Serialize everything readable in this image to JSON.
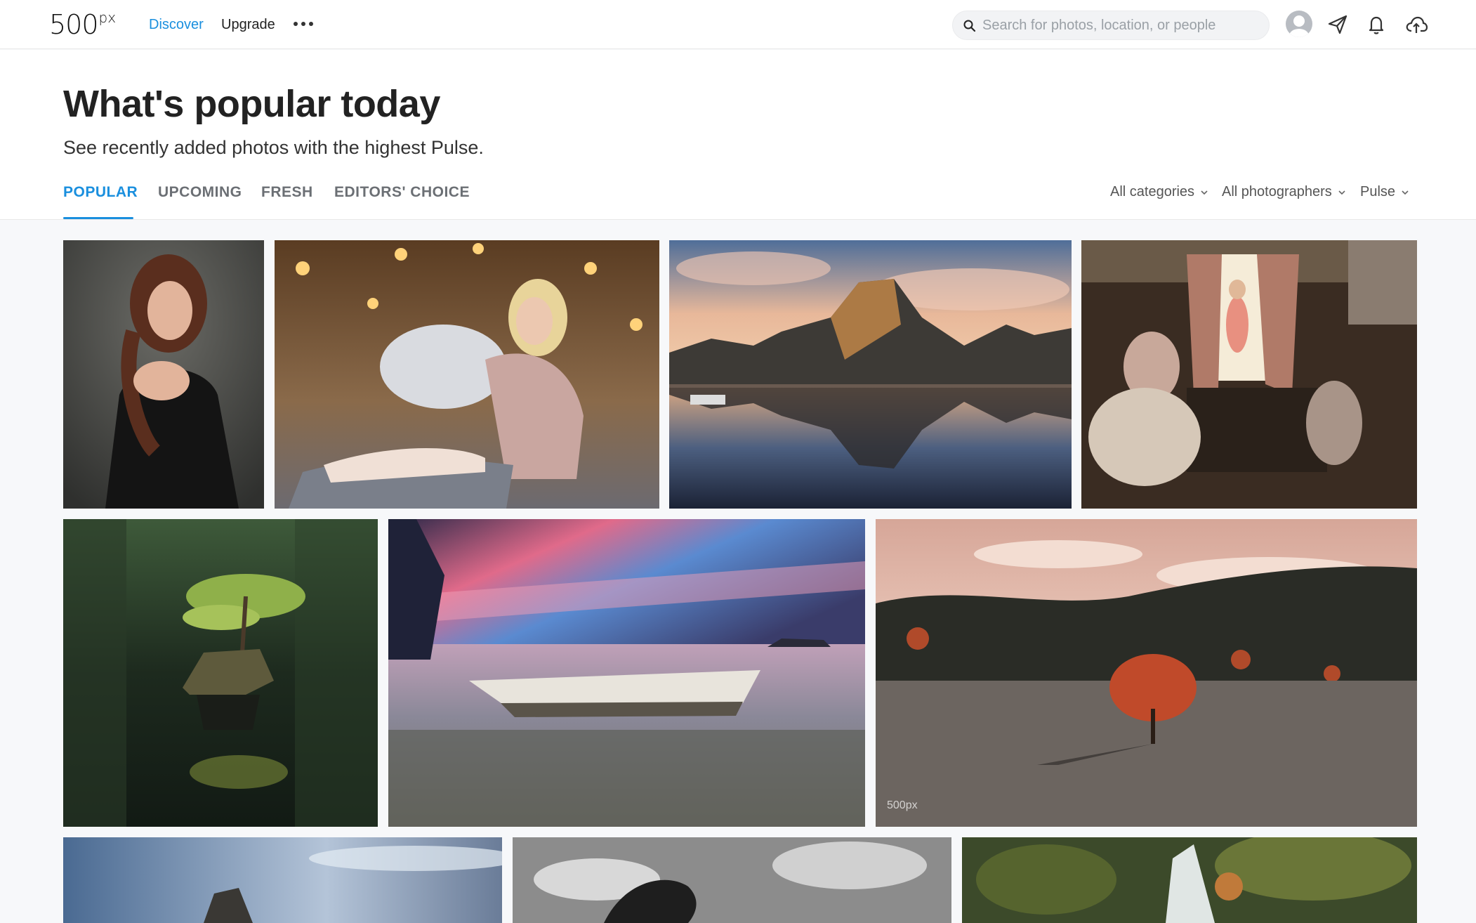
{
  "nav": {
    "logo_main": "500",
    "logo_sup": "px",
    "discover": "Discover",
    "upgrade": "Upgrade"
  },
  "search": {
    "placeholder": "Search for photos, location, or people"
  },
  "header": {
    "title": "What's popular today",
    "subtitle": "See recently added photos with the highest Pulse."
  },
  "tabs": [
    "POPULAR",
    "UPCOMING",
    "FRESH",
    "EDITORS' CHOICE"
  ],
  "active_tab": "POPULAR",
  "filters": {
    "categories": "All categories",
    "photographers": "All photographers",
    "sort": "Pulse"
  },
  "photo_watermark": "500px",
  "colors": {
    "accent": "#1a8fde"
  }
}
